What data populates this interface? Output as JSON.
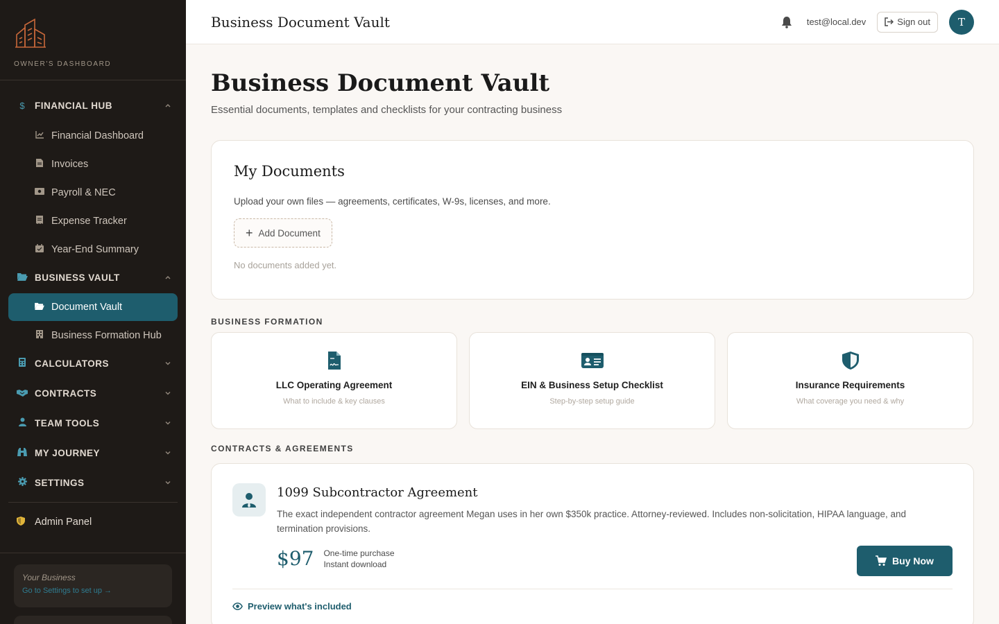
{
  "brand": {
    "subtitle": "OWNER'S DASHBOARD"
  },
  "colors": {
    "accent": "#1e5d6d",
    "sidebar_bg": "#1e1a17",
    "admin_icon": "#e0b43a"
  },
  "sidebar": {
    "financial_hub": {
      "label": "FINANCIAL HUB",
      "items": [
        "Financial Dashboard",
        "Invoices",
        "Payroll & NEC",
        "Expense Tracker",
        "Year-End Summary"
      ]
    },
    "business_vault": {
      "label": "BUSINESS VAULT",
      "items": [
        "Document Vault",
        "Business Formation Hub"
      ]
    },
    "calculators": "CALCULATORS",
    "contracts": "CONTRACTS",
    "team_tools": "TEAM TOOLS",
    "my_journey": "MY JOURNEY",
    "settings": "SETTINGS",
    "admin": "Admin Panel",
    "business_card": {
      "title": "Your Business",
      "link": "Go to Settings to set up →"
    }
  },
  "header": {
    "title": "Business Document Vault",
    "email": "test@local.dev",
    "sign_out": "Sign out",
    "avatar_initial": "T"
  },
  "main": {
    "title": "Business Document Vault",
    "subtitle": "Essential documents, templates and checklists for your contracting business",
    "my_documents": {
      "title": "My Documents",
      "description": "Upload your own files — agreements, certificates, W-9s, licenses, and more.",
      "add_label": "Add Document",
      "empty": "No documents added yet."
    },
    "business_formation": {
      "label": "BUSINESS FORMATION",
      "cards": [
        {
          "title": "LLC Operating Agreement",
          "subtitle": "What to include & key clauses",
          "icon": "document-signature-icon"
        },
        {
          "title": "EIN & Business Setup Checklist",
          "subtitle": "Step-by-step setup guide",
          "icon": "id-card-icon"
        },
        {
          "title": "Insurance Requirements",
          "subtitle": "What coverage you need & why",
          "icon": "shield-icon"
        }
      ]
    },
    "contracts": {
      "label": "CONTRACTS & AGREEMENTS",
      "title": "1099 Subcontractor Agreement",
      "description": "The exact independent contractor agreement Megan uses in her own $350k practice. Attorney-reviewed. Includes non-solicitation, HIPAA language, and termination provisions.",
      "price": "$97",
      "meta1": "One-time purchase",
      "meta2": "Instant download",
      "buy_label": "Buy Now",
      "preview_label": "Preview what's included"
    }
  }
}
